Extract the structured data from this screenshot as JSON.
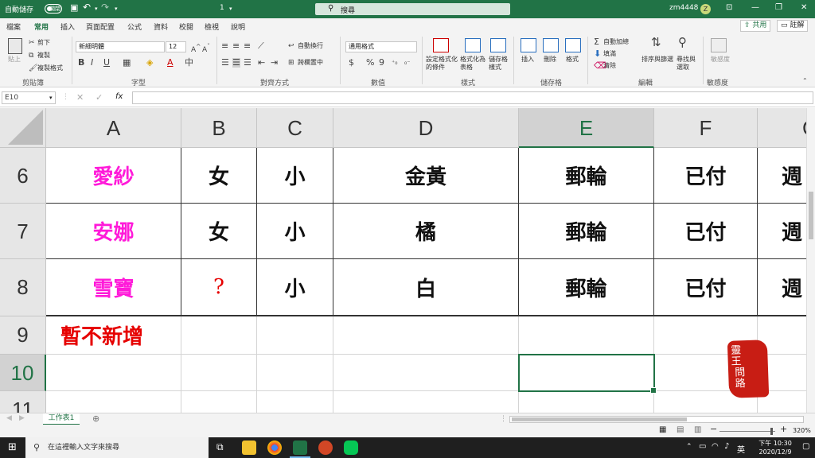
{
  "titlebar": {
    "autosave_label": "自動儲存",
    "autosave_state": "關閉",
    "doc_name": "1",
    "search_placeholder": "搜尋",
    "user": "zm4448",
    "avatar_initial": "Z"
  },
  "ribbon_tabs": [
    "檔案",
    "常用",
    "插入",
    "頁面配置",
    "公式",
    "資料",
    "校閱",
    "檢視",
    "說明"
  ],
  "active_tab": "常用",
  "share_label": "共用",
  "comments_label": "註解",
  "clipboard": {
    "paste": "貼上",
    "cut": "剪下",
    "copy": "複製",
    "format_painter": "複製格式",
    "label": "剪貼簿"
  },
  "font": {
    "name": "新細明體",
    "size": "12",
    "label": "字型",
    "bold": "B",
    "italic": "I",
    "underline": "U"
  },
  "alignment": {
    "wrap": "自動換行",
    "merge": "跨欄置中",
    "label": "對齊方式"
  },
  "number": {
    "format": "通用格式",
    "currency": "$",
    "percent": "%",
    "comma": "9",
    "label": "數值"
  },
  "styles": {
    "conditional": "設定格式化的條件",
    "table": "格式化為表格",
    "cell": "儲存格樣式",
    "label": "樣式"
  },
  "cells": {
    "insert": "插入",
    "delete": "刪除",
    "format": "格式",
    "label": "儲存格"
  },
  "editing": {
    "autosum": "自動加總",
    "fill": "填滿",
    "clear": "清除",
    "sort": "排序與篩選",
    "find": "尋找與選取",
    "label": "編輯"
  },
  "sensitivity": {
    "label": "敏感度",
    "button": "敏感度"
  },
  "formula_bar": {
    "name_box": "E10",
    "fx": "fx",
    "value": ""
  },
  "columns": [
    "A",
    "B",
    "C",
    "D",
    "E",
    "F",
    "G"
  ],
  "rows": [
    "6",
    "7",
    "8",
    "9",
    "10",
    "11"
  ],
  "cells_data": {
    "r6": {
      "A": "愛紗",
      "B": "女",
      "C": "小",
      "D": "金黃",
      "E": "郵輪",
      "F": "已付",
      "G": "週"
    },
    "r7": {
      "A": "安娜",
      "B": "女",
      "C": "小",
      "D": "橘",
      "E": "郵輪",
      "F": "已付",
      "G": "週"
    },
    "r8": {
      "A": "雪寶",
      "B": "?",
      "C": "小",
      "D": "白",
      "E": "郵輪",
      "F": "已付",
      "G": "週"
    },
    "r9": {
      "A": "暫不新增"
    }
  },
  "seal_text": "靈王問路",
  "sheet_tab": "工作表1",
  "zoom": "320%",
  "taskbar": {
    "search_placeholder": "在這裡輸入文字來搜尋",
    "ime": "英",
    "time": "下午 10:30",
    "date": "2020/12/9"
  },
  "colors": {
    "excel_green": "#217346",
    "pink": "#ff1ad9",
    "red": "#e60000"
  }
}
